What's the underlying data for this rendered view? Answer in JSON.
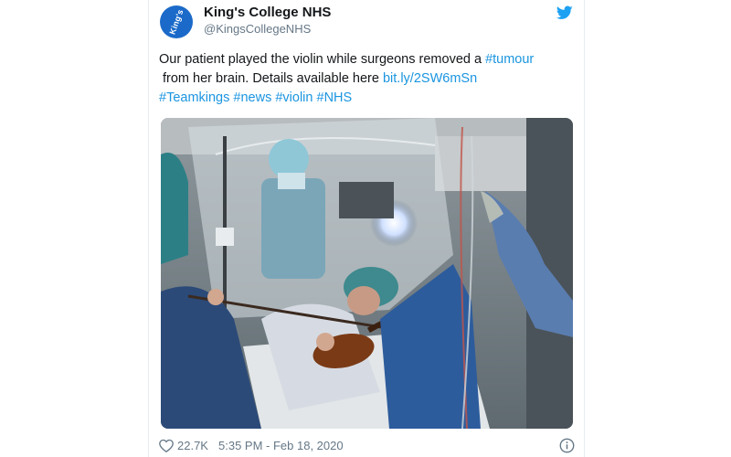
{
  "author": {
    "display_name": "King's College NHS",
    "handle": "@KingsCollegeNHS",
    "avatar_text": "King's"
  },
  "tweet": {
    "line1_text": "Our patient played the violin while surgeons removed a ",
    "line1_hashtag": "#tumour",
    "line2_text": "from her brain. Details available here ",
    "line2_link": "bit.ly/2SW6mSn",
    "hashtags": [
      "#Teamkings",
      "#news",
      "#violin",
      "#NHS"
    ]
  },
  "footer": {
    "like_count": "22.7K",
    "timestamp": "5:35 PM - Feb 18, 2020"
  },
  "icons": {
    "brand": "twitter-bird-icon",
    "like": "heart-icon",
    "info": "info-icon"
  },
  "colors": {
    "link": "#1b95e0",
    "twitter_blue": "#1da1f2",
    "avatar_bg": "#1b6ac9",
    "text": "#14171a",
    "muted": "#657786"
  }
}
